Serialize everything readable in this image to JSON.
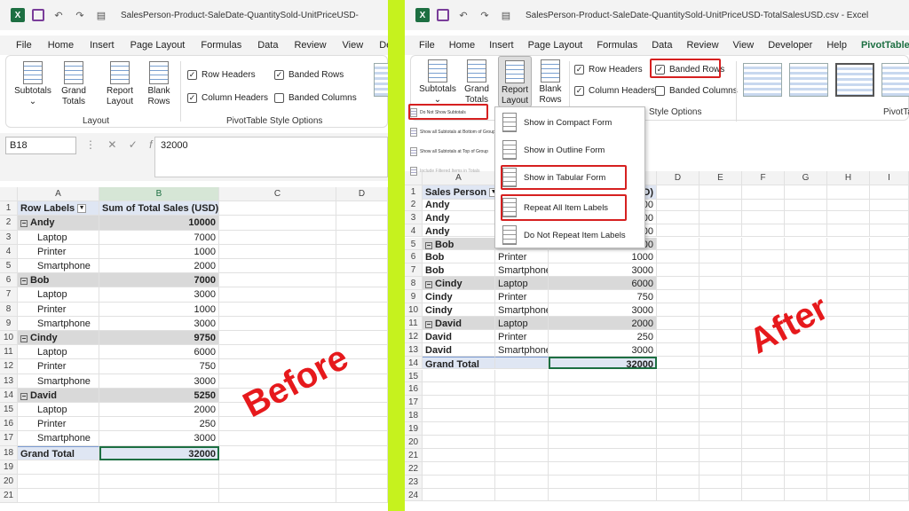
{
  "left": {
    "title": "SalesPerson-Product-SaleDate-QuantitySold-UnitPriceUSD-",
    "menu": [
      "File",
      "Home",
      "Insert",
      "Page Layout",
      "Formulas",
      "Data",
      "Review",
      "View",
      "Deve"
    ],
    "ribbon": {
      "subtotals": "Subtotals",
      "grand_totals": "Grand Totals",
      "report_layout": "Report Layout",
      "blank_rows": "Blank Rows",
      "layout_group": "Layout",
      "row_headers": "Row Headers",
      "column_headers": "Column Headers",
      "banded_rows": "Banded Rows",
      "banded_columns": "Banded Columns",
      "style_options_group": "PivotTable Style Options"
    },
    "name_box": "B18",
    "formula": "32000",
    "columns": [
      "A",
      "B",
      "C",
      "D"
    ],
    "header": {
      "a": "Row Labels",
      "b": "Sum of Total Sales (USD)"
    },
    "rows": [
      {
        "n": "2",
        "label": "Andy",
        "value": "10000",
        "kind": "group"
      },
      {
        "n": "3",
        "label": "Laptop",
        "value": "7000",
        "kind": "item"
      },
      {
        "n": "4",
        "label": "Printer",
        "value": "1000",
        "kind": "item"
      },
      {
        "n": "5",
        "label": "Smartphone",
        "value": "2000",
        "kind": "item"
      },
      {
        "n": "6",
        "label": "Bob",
        "value": "7000",
        "kind": "group"
      },
      {
        "n": "7",
        "label": "Laptop",
        "value": "3000",
        "kind": "item"
      },
      {
        "n": "8",
        "label": "Printer",
        "value": "1000",
        "kind": "item"
      },
      {
        "n": "9",
        "label": "Smartphone",
        "value": "3000",
        "kind": "item"
      },
      {
        "n": "10",
        "label": "Cindy",
        "value": "9750",
        "kind": "group"
      },
      {
        "n": "11",
        "label": "Laptop",
        "value": "6000",
        "kind": "item"
      },
      {
        "n": "12",
        "label": "Printer",
        "value": "750",
        "kind": "item"
      },
      {
        "n": "13",
        "label": "Smartphone",
        "value": "3000",
        "kind": "item"
      },
      {
        "n": "14",
        "label": "David",
        "value": "5250",
        "kind": "group"
      },
      {
        "n": "15",
        "label": "Laptop",
        "value": "2000",
        "kind": "item"
      },
      {
        "n": "16",
        "label": "Printer",
        "value": "250",
        "kind": "item"
      },
      {
        "n": "17",
        "label": "Smartphone",
        "value": "3000",
        "kind": "item"
      },
      {
        "n": "18",
        "label": "Grand Total",
        "value": "32000",
        "kind": "grand"
      },
      {
        "n": "19",
        "label": "",
        "value": "",
        "kind": "empty"
      },
      {
        "n": "20",
        "label": "",
        "value": "",
        "kind": "empty"
      },
      {
        "n": "21",
        "label": "",
        "value": "",
        "kind": "empty"
      }
    ],
    "row1": "1",
    "before_label": "Before"
  },
  "right": {
    "title": "SalesPerson-Product-SaleDate-QuantitySold-UnitPriceUSD-TotalSalesUSD.csv - Excel",
    "menu": [
      "File",
      "Home",
      "Insert",
      "Page Layout",
      "Formulas",
      "Data",
      "Review",
      "View",
      "Developer",
      "Help",
      "PivotTable Analyze"
    ],
    "ribbon": {
      "subtotals": "Subtotals",
      "grand_totals": "Grand Totals",
      "report_layout": "Report Layout",
      "blank_rows": "Blank Rows",
      "row_headers": "Row Headers",
      "column_headers": "Column Headers",
      "banded_rows": "Banded Rows",
      "banded_columns": "Banded Columns",
      "style_options_group": "Style Options",
      "pivot_style_group": "PivotTab"
    },
    "subtotal_menu": [
      "Do Not Show Subtotals",
      "Show all Subtotals at Bottom of Group",
      "Show all Subtotals at Top of Group",
      "Include Filtered Items in Totals"
    ],
    "layout_menu": [
      "Show in Compact Form",
      "Show in Outline Form",
      "Show in Tabular Form",
      "Repeat All Item Labels",
      "Do Not Repeat Item Labels"
    ],
    "columns": [
      "A",
      "D",
      "E",
      "F",
      "G",
      "H",
      "I"
    ],
    "header": {
      "a": "Sales Person",
      "c": "D)"
    },
    "rows": [
      {
        "n": "2",
        "a": "Andy",
        "b": "",
        "c": "000",
        "kind": "plain"
      },
      {
        "n": "3",
        "a": "Andy",
        "b": "",
        "c": "000",
        "kind": "plain"
      },
      {
        "n": "4",
        "a": "Andy",
        "b": "",
        "c": "000",
        "kind": "plain"
      },
      {
        "n": "5",
        "a": "Bob",
        "b": "",
        "c": "000",
        "kind": "band"
      },
      {
        "n": "6",
        "a": "Bob",
        "b": "Printer",
        "c": "1000",
        "kind": "plain"
      },
      {
        "n": "7",
        "a": "Bob",
        "b": "Smartphone",
        "c": "3000",
        "kind": "plain"
      },
      {
        "n": "8",
        "a": "Cindy",
        "b": "Laptop",
        "c": "6000",
        "kind": "band"
      },
      {
        "n": "9",
        "a": "Cindy",
        "b": "Printer",
        "c": "750",
        "kind": "plain"
      },
      {
        "n": "10",
        "a": "Cindy",
        "b": "Smartphone",
        "c": "3000",
        "kind": "plain"
      },
      {
        "n": "11",
        "a": "David",
        "b": "Laptop",
        "c": "2000",
        "kind": "band"
      },
      {
        "n": "12",
        "a": "David",
        "b": "Printer",
        "c": "250",
        "kind": "plain"
      },
      {
        "n": "13",
        "a": "David",
        "b": "Smartphone",
        "c": "3000",
        "kind": "plain"
      },
      {
        "n": "14",
        "a": "Grand Total",
        "b": "",
        "c": "32000",
        "kind": "grand"
      },
      {
        "n": "15",
        "a": "",
        "b": "",
        "c": "",
        "kind": "empty"
      },
      {
        "n": "16",
        "a": "",
        "b": "",
        "c": "",
        "kind": "empty"
      },
      {
        "n": "17",
        "a": "",
        "b": "",
        "c": "",
        "kind": "empty"
      },
      {
        "n": "18",
        "a": "",
        "b": "",
        "c": "",
        "kind": "empty"
      },
      {
        "n": "19",
        "a": "",
        "b": "",
        "c": "",
        "kind": "empty"
      },
      {
        "n": "20",
        "a": "",
        "b": "",
        "c": "",
        "kind": "empty"
      },
      {
        "n": "21",
        "a": "",
        "b": "",
        "c": "",
        "kind": "empty"
      },
      {
        "n": "22",
        "a": "",
        "b": "",
        "c": "",
        "kind": "empty"
      },
      {
        "n": "23",
        "a": "",
        "b": "",
        "c": "",
        "kind": "empty"
      },
      {
        "n": "24",
        "a": "",
        "b": "",
        "c": "",
        "kind": "empty"
      }
    ],
    "row1": "1",
    "after_label": "After"
  },
  "colors": {
    "excel_green": "#1d6f42",
    "highlight_red": "#d62020",
    "divider": "#c6f21e",
    "banded": "#d9d9d9",
    "header_blue": "#dfe6f3"
  }
}
